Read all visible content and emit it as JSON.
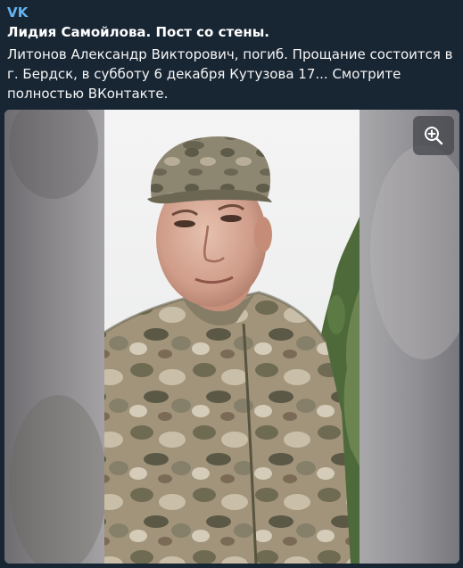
{
  "post": {
    "source_label": "VK",
    "title": "Лидия Самойлова. Пост со стены.",
    "body": "Литонов Александр Викторович, погиб. Прощание состоится в г. Бердск, в субботу 6 декабря Кутузова 17... Смотрите полностью ВКонтакте."
  },
  "media": {
    "zoom_icon": "zoom-in-icon"
  },
  "colors": {
    "background": "#182533",
    "link": "#64b5ef",
    "text": "#ffffff"
  }
}
